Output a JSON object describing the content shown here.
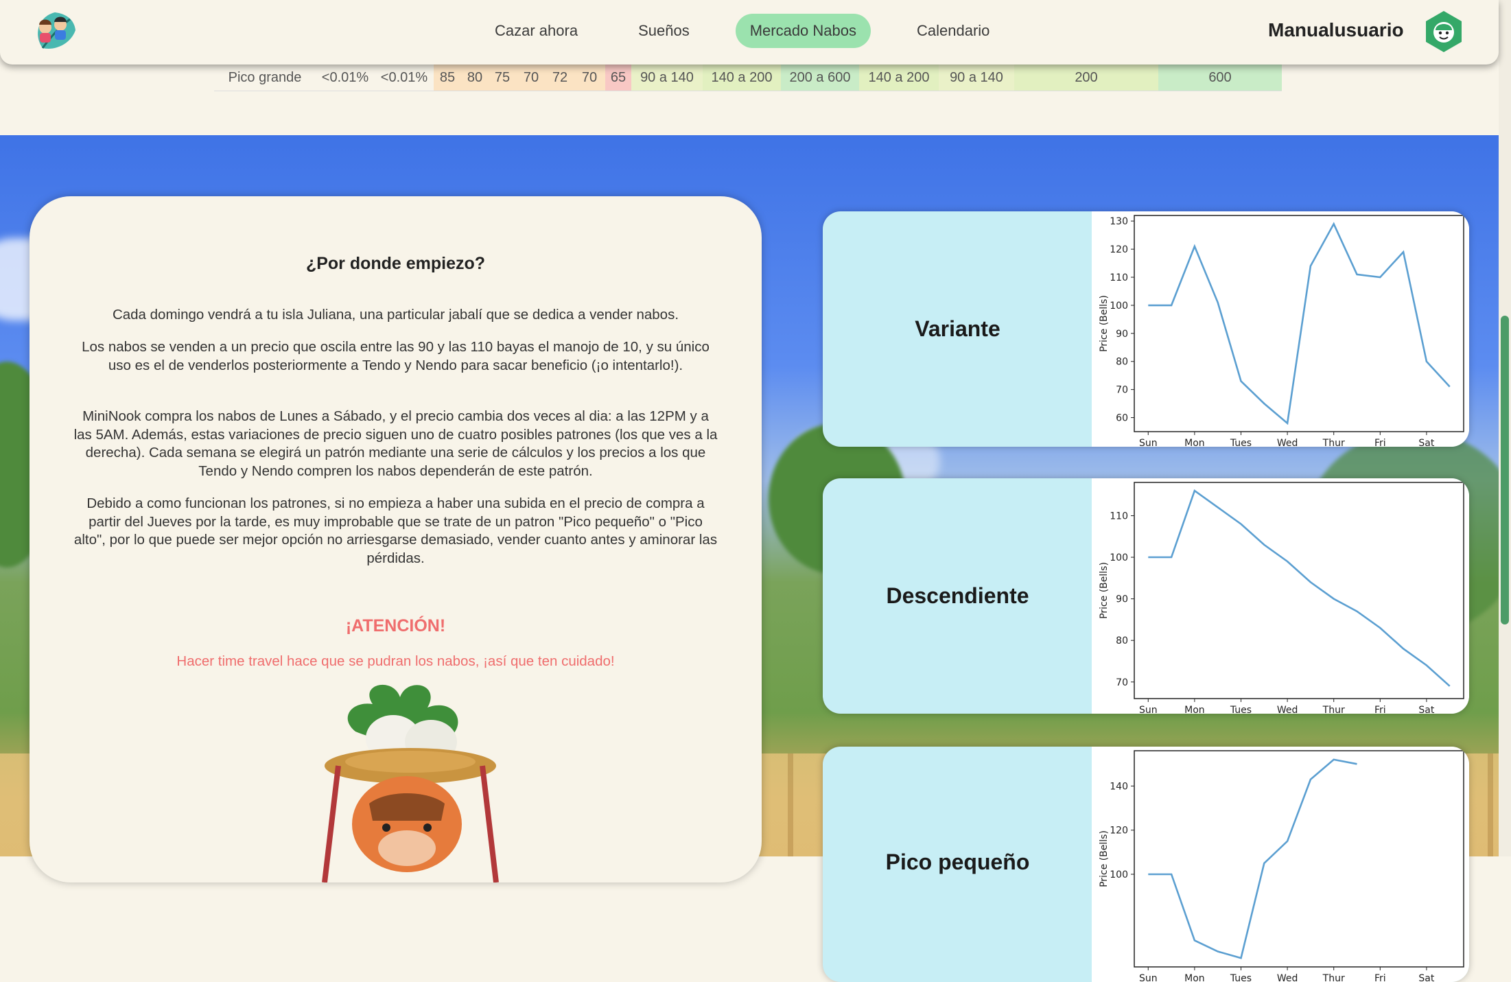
{
  "header": {
    "nav": [
      "Cazar ahora",
      "Sueños",
      "Mercado Nabos",
      "Calendario"
    ],
    "active_index": 2,
    "username": "Manualusuario"
  },
  "price_table": {
    "row_label": "Pico grande",
    "cells": [
      {
        "text": "<0.01%",
        "color": "#f8f4e9"
      },
      {
        "text": "<0.01%",
        "color": "#f8f4e9"
      },
      {
        "text": "85",
        "color": "#fbe3c3"
      },
      {
        "text": "80",
        "color": "#fbe3c3"
      },
      {
        "text": "75",
        "color": "#fbe3c3"
      },
      {
        "text": "70",
        "color": "#fbe3c3"
      },
      {
        "text": "72",
        "color": "#fbe3c3"
      },
      {
        "text": "70",
        "color": "#fbe3c3"
      },
      {
        "text": "65",
        "color": "#f8c8c4"
      },
      {
        "text": "90 a 140",
        "color": "#eaf1c8"
      },
      {
        "text": "140 a 200",
        "color": "#e2f0c0"
      },
      {
        "text": "200 a 600",
        "color": "#c9ecc7"
      },
      {
        "text": "140 a 200",
        "color": "#e2f0c0"
      },
      {
        "text": "90 a 140",
        "color": "#eaf1c8"
      },
      {
        "text": "200",
        "color": "#e2f0c0"
      },
      {
        "text": "600",
        "color": "#c9ecc7"
      }
    ]
  },
  "info": {
    "title": "¿Por donde empiezo?",
    "paragraphs": [
      "Cada domingo vendrá a tu isla Juliana, una particular jabalí que se dedica a vender nabos.",
      "Los nabos se venden a un precio que oscila entre las 90 y las 110 bayas el manojo de 10, y su único uso es el de venderlos posteriormente a Tendo y Nendo para sacar beneficio (¡o intentarlo!).",
      "MiniNook compra los nabos de Lunes a Sábado, y el precio cambia dos veces al dia: a las 12PM y a las 5AM. Además, estas variaciones de precio siguen uno de cuatro posibles patrones (los que ves a la derecha). Cada semana se elegirá un patrón mediante una serie de cálculos y los precios a los que Tendo y Nendo compren los nabos dependerán de este patrón.",
      "Debido a como funcionan los patrones, si no empieza a haber una subida en el precio de compra a partir del Jueves por la tarde, es muy improbable que se trate de un patron \"Pico pequeño\" o \"Pico alto\", por lo que puede ser mejor opción no arriesgarse demasiado, vender cuanto antes y aminorar las pérdidas."
    ],
    "attention": "¡ATENCIÓN!",
    "warning": "Hacer time travel hace que se pudran los nabos, ¡así que ten cuidado!"
  },
  "patterns": [
    {
      "name": "Variante"
    },
    {
      "name": "Descendiente"
    },
    {
      "name": "Pico pequeño"
    }
  ],
  "chart_data": [
    {
      "type": "line",
      "series_color": "#5b9fd1",
      "ylabel": "Price (Bells)",
      "x": [
        0,
        0.5,
        1,
        1.5,
        2,
        2.5,
        3,
        3.5,
        4,
        4.5,
        5,
        5.5,
        6,
        6.5
      ],
      "y": [
        100,
        100,
        121,
        101,
        73,
        65,
        58,
        114,
        129,
        111,
        110,
        119,
        80,
        71
      ],
      "xticks": [
        "Sun",
        "Mon",
        "Tues",
        "Wed",
        "Thur",
        "Fri",
        "Sat"
      ],
      "yticks": [
        60,
        70,
        80,
        90,
        100,
        110,
        120,
        130
      ],
      "ylim": [
        55,
        132
      ]
    },
    {
      "type": "line",
      "series_color": "#5b9fd1",
      "ylabel": "Price (Bells)",
      "x": [
        0,
        0.5,
        1,
        1.5,
        2,
        2.5,
        3,
        3.5,
        4,
        4.5,
        5,
        5.5,
        6,
        6.5
      ],
      "y": [
        100,
        100,
        116,
        112,
        108,
        103,
        99,
        94,
        90,
        87,
        83,
        78,
        74,
        69
      ],
      "xticks": [
        "Sun",
        "Mon",
        "Tues",
        "Wed",
        "Thur",
        "Fri",
        "Sat"
      ],
      "yticks": [
        70,
        80,
        90,
        100,
        110
      ],
      "ylim": [
        66,
        118
      ]
    },
    {
      "type": "line",
      "series_color": "#5b9fd1",
      "ylabel": "Price (Bells)",
      "x": [
        0,
        0.5,
        1,
        1.5,
        2,
        2.5,
        3,
        3.5,
        4,
        4.5
      ],
      "y": [
        100,
        100,
        70,
        65,
        62,
        105,
        115,
        143,
        152,
        150
      ],
      "xticks": [
        "Sun",
        "Mon",
        "Tues",
        "Wed",
        "Thur",
        "Fri",
        "Sat"
      ],
      "yticks": [
        100,
        120,
        140
      ],
      "ylim": [
        58,
        156
      ]
    }
  ]
}
